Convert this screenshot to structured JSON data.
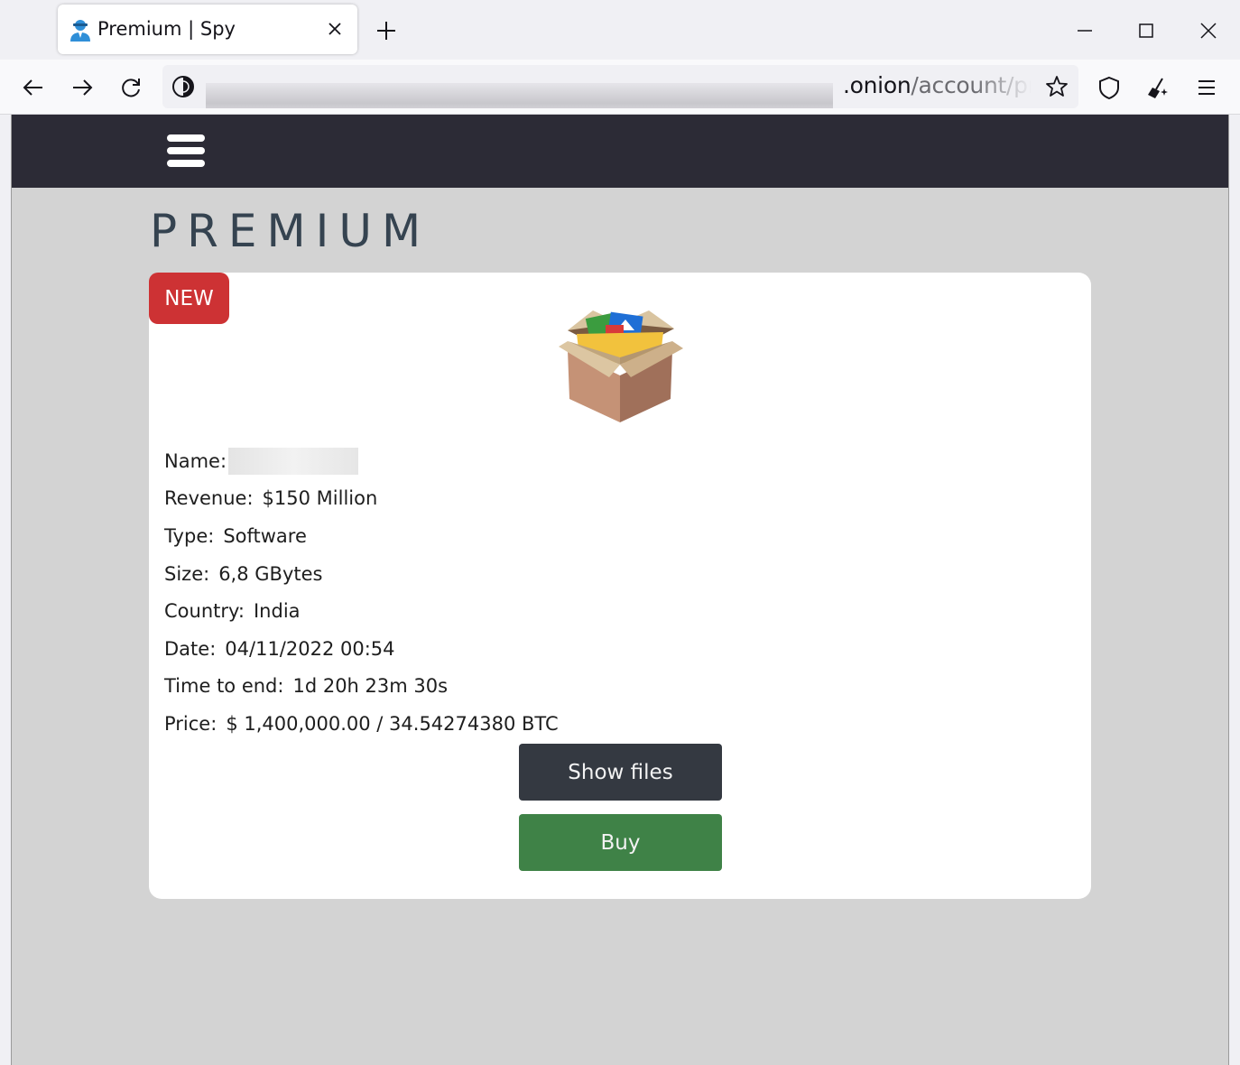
{
  "browser": {
    "tab_title": "Premium | Spy",
    "url_visible": ".onion",
    "url_path": "/account/pre"
  },
  "page": {
    "title": "PREMIUM",
    "card": {
      "badge": "NEW",
      "fields": [
        {
          "label": "Name:",
          "value": ""
        },
        {
          "label": "Revenue:",
          "value": "$150 Million"
        },
        {
          "label": "Type:",
          "value": "Software"
        },
        {
          "label": "Size:",
          "value": "6,8 GBytes"
        },
        {
          "label": "Country:",
          "value": "India"
        },
        {
          "label": "Date:",
          "value": "04/11/2022 00:54"
        },
        {
          "label": "Time to end:",
          "value": "1d 20h 23m 30s"
        },
        {
          "label": "Price:",
          "value": "$ 1,400,000.00 / 34.54274380 BTC"
        }
      ],
      "show_files_label": "Show files",
      "buy_label": "Buy"
    }
  },
  "icons": {
    "favicon": "spy-user-icon",
    "product": "open-box-with-files-icon"
  },
  "colors": {
    "header_bg": "#2c2b36",
    "page_bg": "#d3d3d3",
    "badge": "#cd3234",
    "show_files_button": "#343941",
    "buy_button": "#3f8247",
    "title_text": "#354350"
  }
}
